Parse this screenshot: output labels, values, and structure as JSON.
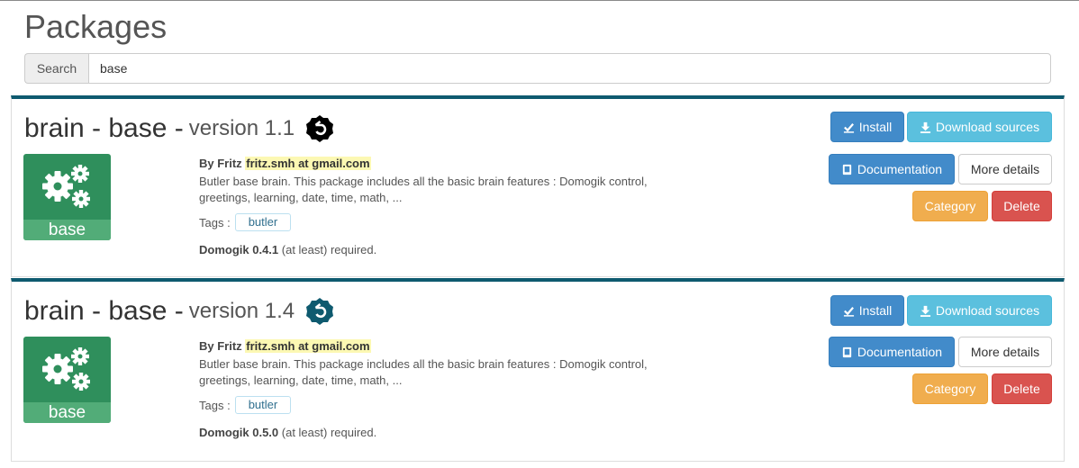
{
  "page": {
    "title": "Packages"
  },
  "search": {
    "label": "Search",
    "value": "base"
  },
  "packages": [
    {
      "name": "brain - base -",
      "version": "version 1.1",
      "logo_label": "base",
      "author_prefix": "By Fritz",
      "author_email": "fritz.smh at gmail.com",
      "description": "Butler base brain. This package includes all the basic brain features : Domogik control, greetings, learning, date, time, math, ...",
      "tags_label": "Tags :",
      "tags": [
        "butler"
      ],
      "requirement_version": "Domogik 0.4.1",
      "requirement_suffix": "(at least) required.",
      "buttons": {
        "install": "Install",
        "download": "Download sources",
        "documentation": "Documentation",
        "details": "More details",
        "category": "Category",
        "delete": "Delete"
      }
    },
    {
      "name": "brain - base -",
      "version": "version 1.4",
      "logo_label": "base",
      "author_prefix": "By Fritz",
      "author_email": "fritz.smh at gmail.com",
      "description": "Butler base brain. This package includes all the basic brain features : Domogik control, greetings, learning, date, time, math, ...",
      "tags_label": "Tags :",
      "tags": [
        "butler"
      ],
      "requirement_version": "Domogik 0.5.0",
      "requirement_suffix": "(at least) required.",
      "buttons": {
        "install": "Install",
        "download": "Download sources",
        "documentation": "Documentation",
        "details": "More details",
        "category": "Category",
        "delete": "Delete"
      }
    }
  ],
  "colors": {
    "card_accent": "#0e5a6f",
    "logo_green": "#2f8f5c",
    "version_icon_1": "#000000",
    "version_icon_2": "#0e5a6f"
  },
  "icons": {
    "version": "domogik-logo-icon",
    "install": "check-icon",
    "download": "download-icon",
    "documentation": "book-icon",
    "logo": "gears-icon"
  }
}
